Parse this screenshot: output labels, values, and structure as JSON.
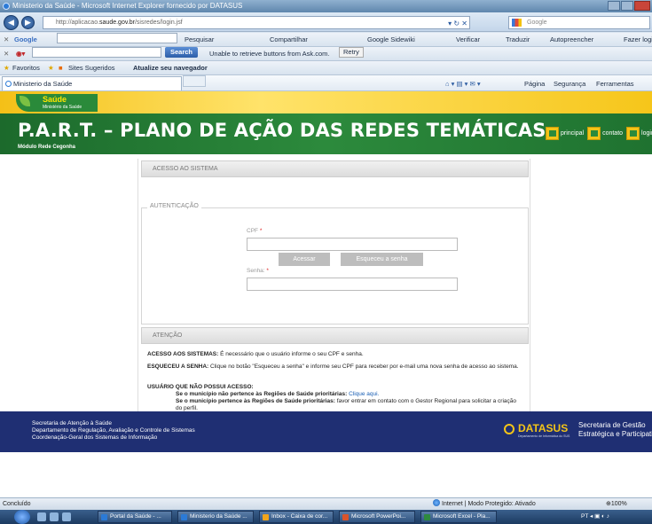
{
  "window": {
    "title": "Ministerio da Saúde - Microsoft Internet Explorer fornecido por DATASUS"
  },
  "address_bar": {
    "url_prefix": "http://aplicacao.",
    "url_domain": "saude.gov.br",
    "url_suffix": "/sisredes/login.jsf",
    "search_placeholder": "Google"
  },
  "google_toolbar": {
    "label": "Google",
    "items": [
      "Pesquisar",
      "Compartilhar",
      "Google Sidewiki",
      "Verificar",
      "Traduzir",
      "Autopreencher",
      "Fazer login"
    ]
  },
  "ask_toolbar": {
    "search_label": "Search",
    "message": "Unable to retrieve buttons from Ask.com.",
    "retry_label": "Retry"
  },
  "favorites_bar": {
    "favorites_label": "Favoritos",
    "suggested_label": "Sites Sugeridos",
    "update_label": "Atualize seu navegador"
  },
  "tab": {
    "title": "Ministerio da Saúde",
    "commands": [
      "Página",
      "Segurança",
      "Ferramentas"
    ]
  },
  "site": {
    "logo_title": "Saúde",
    "logo_subtitle": "Ministério da Saúde",
    "title": "P.A.R.T. – PLANO DE AÇÃO DAS REDES TEMÁTICAS",
    "subtitle": "Módulo Rede Cegonha",
    "nav": {
      "principal": "principal",
      "contato": "contato",
      "login": "login"
    }
  },
  "login": {
    "section_title": "ACESSO AO SISTEMA",
    "fieldset_legend": "AUTENTICAÇÃO",
    "cpf_label": "CPF",
    "senha_label": "Senha:",
    "required_mark": "*",
    "acessar_label": "Acessar",
    "esqueceu_label": "Esqueceu a senha"
  },
  "attention": {
    "title": "ATENÇÃO",
    "p1_bold": "ACESSO AOS SISTEMAS:",
    "p1_text": " É necessário que o usuário informe o seu CPF e senha.",
    "p2_bold": "ESQUECEU A SENHA:",
    "p2_text": " Clique no botão \"Esqueceu a senha\" e informe seu CPF para receber por e-mail uma nova senha de acesso ao sistema.",
    "p3_bold": "USUÁRIO QUE NÃO POSSUI ACESSO:",
    "p3_item1_bold": "Se o município não pertence às Regiões de Saúde prioritárias:",
    "p3_item1_link": "Clique aqui.",
    "p3_item2_bold": "Se o município pertence às Regiões de Saúde prioritárias:",
    "p3_item2_text": " favor entrar em contato com o Gestor Regional para solicitar a criação do perfil."
  },
  "footer": {
    "line1": "Secretaria de Atenção à Saúde",
    "line2": "Departamento de Regulação, Avaliação e Controle de Sistemas",
    "line3": "Coordenação-Geral dos Sistemas de Informação",
    "datasus": "DATASUS",
    "datasus_sub": "Departamento de Informática do SUS",
    "sgep1": "Secretaria de Gestão",
    "sgep2": "Estratégica e Participativa"
  },
  "status_bar": {
    "left": "Concluído",
    "zone": "Internet | Modo Protegido: Ativado",
    "zoom": "100%"
  },
  "taskbar": {
    "items": [
      "Portal da Saúde - ...",
      "Ministerio da Saúde ...",
      "Inbox - Caixa de cor...",
      "Microsoft PowerPoi...",
      "Microsoft Excel - Pla..."
    ],
    "lang": "PT"
  },
  "colors": {
    "site_green": "#2c8a3c",
    "gold": "#f3c418",
    "footer_navy": "#1f2f73"
  }
}
